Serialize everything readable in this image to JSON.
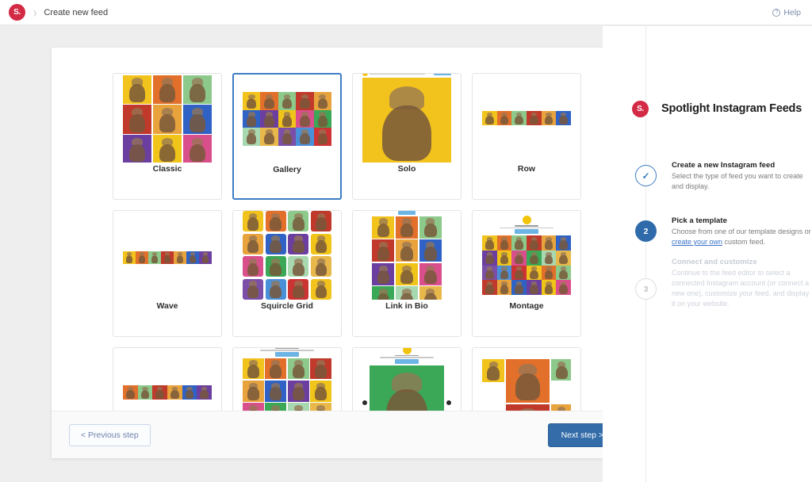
{
  "topbar": {
    "logo_text": "S.",
    "logo_color": "#d32a45",
    "breadcrumb_separator": "›",
    "breadcrumb": "Create new feed",
    "help_label": "Help",
    "help_icon": "question-circle-icon",
    "help_glyph": "?"
  },
  "sidebar": {
    "brand_logo_text": "S.",
    "title": "Spotlight Instagram Feeds",
    "steps": [
      {
        "marker": "✓",
        "state": "done",
        "heading": "Create a new Instagram feed",
        "desc": "Select the type of feed you want to create and display."
      },
      {
        "marker": "2",
        "state": "current",
        "heading": "Pick a template",
        "desc_before": "Choose from one of our template designs or ",
        "link": "create your own",
        "desc_after": " custom feed."
      },
      {
        "marker": "3",
        "state": "pending",
        "heading": "Connect and customize",
        "desc": "Continue to the feed editor to select a connected Instagram account (or connect a new one), customize your feed, and display it on your website."
      }
    ]
  },
  "templates": [
    {
      "label": "Classic",
      "style": "classic",
      "selected": false
    },
    {
      "label": "Gallery",
      "style": "gallery",
      "selected": true
    },
    {
      "label": "Solo",
      "style": "solo",
      "selected": false
    },
    {
      "label": "Row",
      "style": "row",
      "selected": false
    },
    {
      "label": "Wave",
      "style": "wave",
      "selected": false
    },
    {
      "label": "Squircle Grid",
      "style": "squircle",
      "selected": false
    },
    {
      "label": "Link in Bio",
      "style": "linkinbio",
      "selected": false
    },
    {
      "label": "Montage",
      "style": "montage",
      "selected": false
    },
    {
      "label": "",
      "style": "rowwide",
      "selected": false
    },
    {
      "label": "",
      "style": "headergrid",
      "selected": false
    },
    {
      "label": "",
      "style": "carousel",
      "selected": false
    },
    {
      "label": "",
      "style": "mosaic",
      "selected": false
    }
  ],
  "footer": {
    "previous_label": "< Previous step",
    "next_label": "Next step >"
  },
  "palette": {
    "accent_blue": "#3d7dc4",
    "brand_red": "#d32a45",
    "tile_colors": [
      "#f2c31d",
      "#e2702a",
      "#8cc98a",
      "#c0392b",
      "#e8a33d",
      "#2f62c4",
      "#6b3fa0",
      "#f0c419",
      "#d94f8c",
      "#3aa856",
      "#a8d8b0",
      "#e9b84a",
      "#7b4fa8",
      "#4a90d9",
      "#cc3333"
    ]
  }
}
